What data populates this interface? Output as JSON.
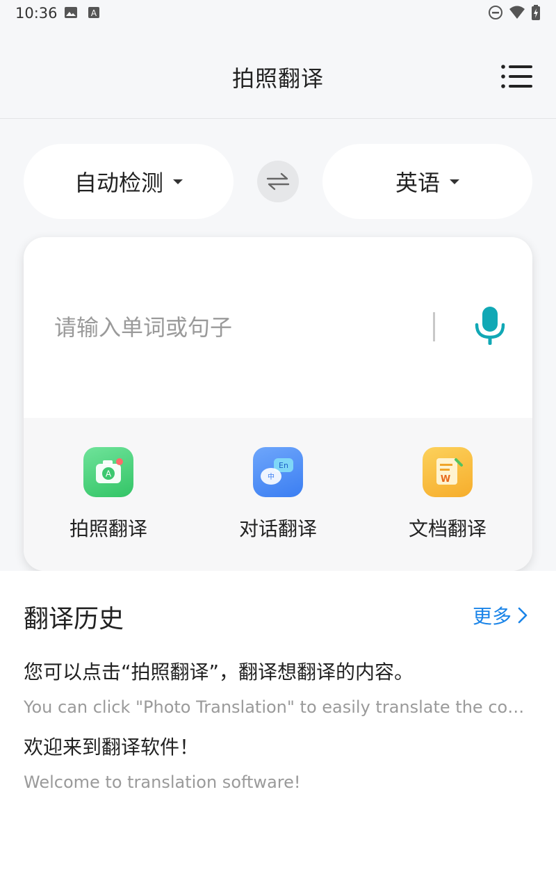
{
  "status_bar": {
    "time": "10:36",
    "left_icons": [
      "image-icon",
      "a-box-icon"
    ],
    "right_icons": [
      "do-not-disturb-icon",
      "wifi-icon",
      "battery-charging-icon"
    ]
  },
  "header": {
    "title": "拍照翻译",
    "menu_icon": "list-menu-icon"
  },
  "languages": {
    "source": "自动检测",
    "target": "英语",
    "swap_icon": "swap-arrows-icon"
  },
  "input": {
    "placeholder": "请输入单词或句子",
    "value": "",
    "mic_icon": "microphone-icon",
    "mic_color": "#11a8b5"
  },
  "tools": [
    {
      "label": "拍照翻译",
      "icon": "camera-translate-icon",
      "color": "#4cd37a"
    },
    {
      "label": "对话翻译",
      "icon": "chat-translate-icon",
      "color": "#4e8ef5"
    },
    {
      "label": "文档翻译",
      "icon": "document-translate-icon",
      "color": "#f9bf3b"
    }
  ],
  "history": {
    "title": "翻译历史",
    "more_label": "更多",
    "accent": "#1a84e8",
    "items": [
      {
        "source": "您可以点击“拍照翻译”，翻译想翻译的内容。",
        "translation": "You can click \"Photo Translation\" to easily translate the content you want to translate."
      },
      {
        "source": "欢迎来到翻译软件！",
        "translation": "Welcome to translation software!"
      }
    ]
  }
}
